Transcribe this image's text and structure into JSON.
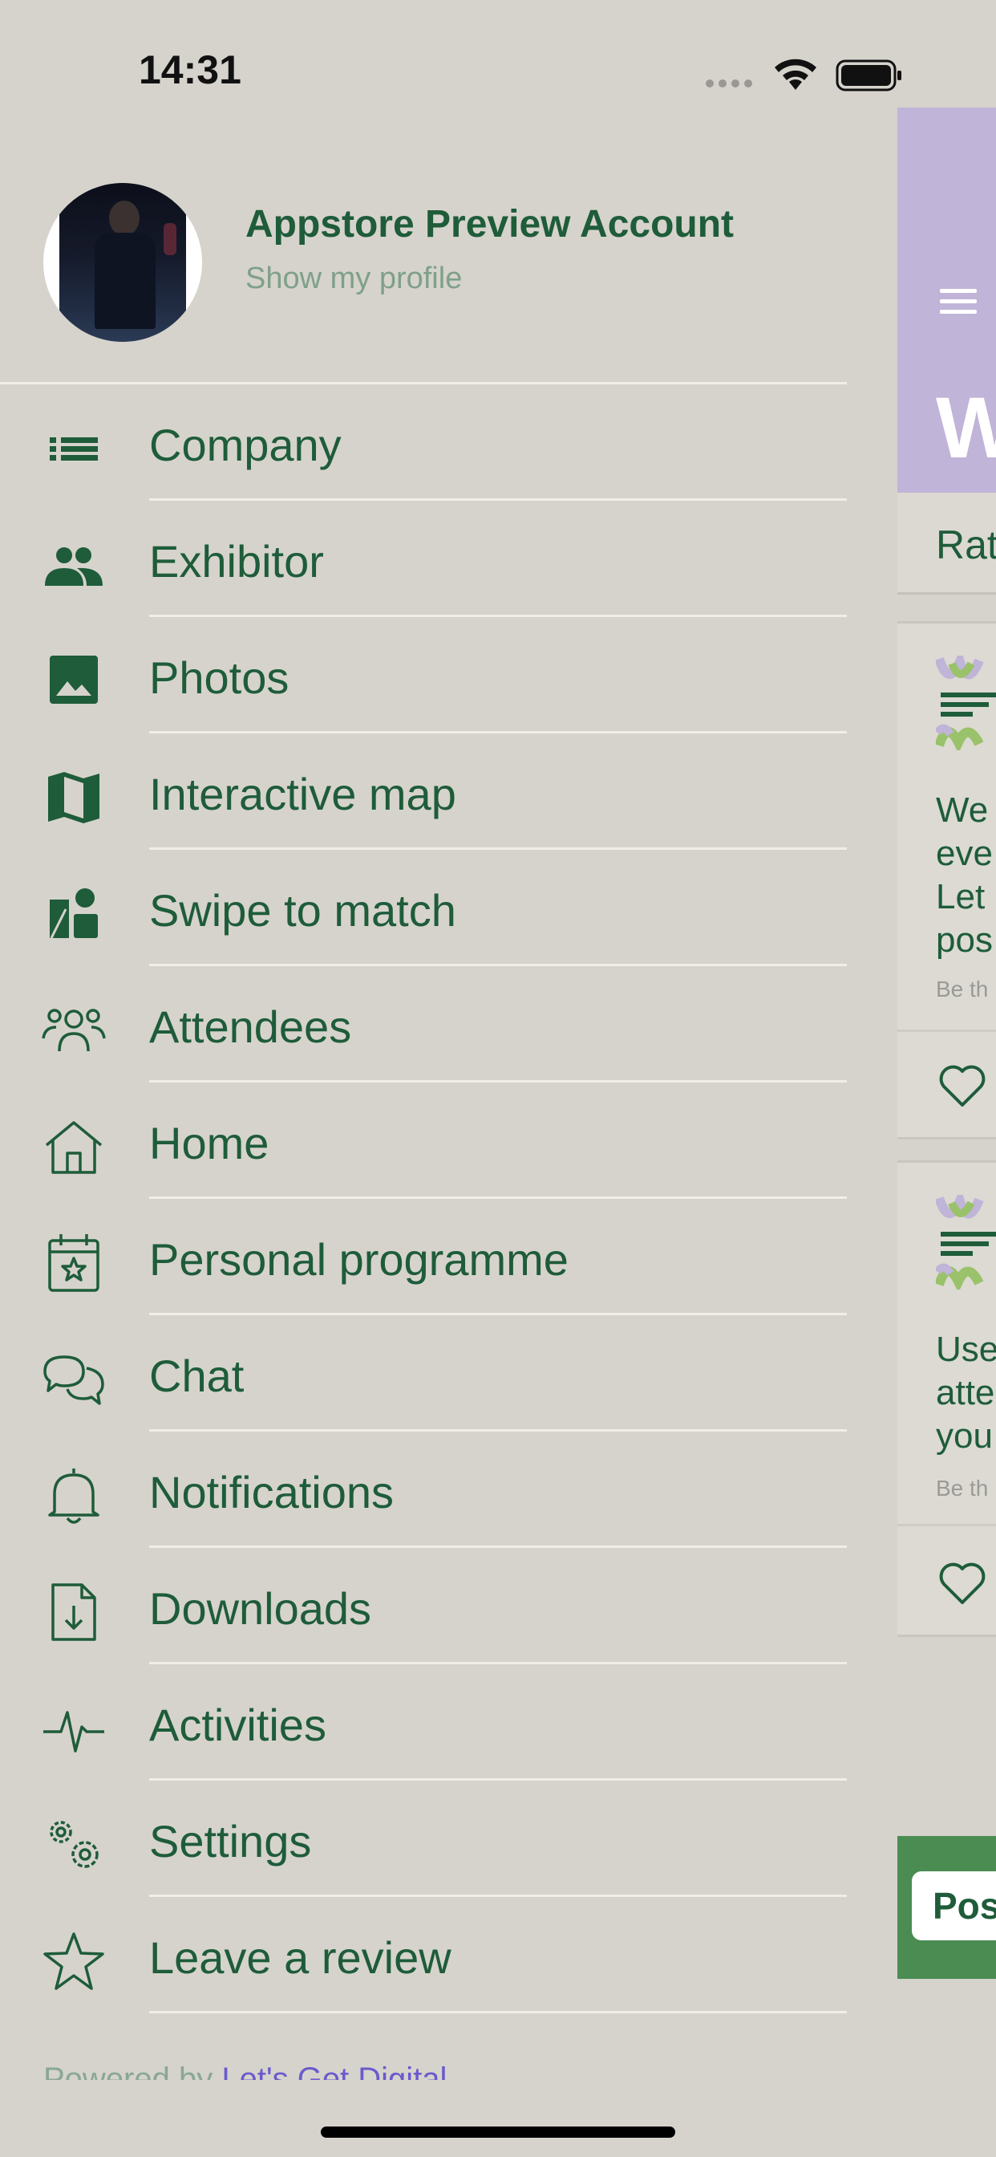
{
  "status_bar": {
    "time": "14:31"
  },
  "profile": {
    "name": "Appstore Preview Account",
    "subtitle": "Show my profile"
  },
  "menu": [
    {
      "label": "Company",
      "icon": "list-icon"
    },
    {
      "label": "Exhibitor",
      "icon": "people-icon"
    },
    {
      "label": "Photos",
      "icon": "image-icon"
    },
    {
      "label": "Interactive map",
      "icon": "map-icon"
    },
    {
      "label": "Swipe to match",
      "icon": "shapes-icon"
    },
    {
      "label": "Attendees",
      "icon": "attendees-icon"
    },
    {
      "label": "Home",
      "icon": "home-icon"
    },
    {
      "label": "Personal programme",
      "icon": "calendar-star-icon"
    },
    {
      "label": "Chat",
      "icon": "chat-icon"
    },
    {
      "label": "Notifications",
      "icon": "bell-icon"
    },
    {
      "label": "Downloads",
      "icon": "download-file-icon"
    },
    {
      "label": "Activities",
      "icon": "activity-icon"
    },
    {
      "label": "Settings",
      "icon": "gears-icon"
    },
    {
      "label": "Leave a review",
      "icon": "star-icon"
    }
  ],
  "footer": {
    "powered_prefix": "Powered by ",
    "powered_link": "Let's Get Digital"
  },
  "background_page": {
    "header_letter": "W",
    "tab_label": "Rat",
    "cards": [
      {
        "text": "We\neve\nLet\npos",
        "meta": "Be th"
      },
      {
        "text": "Use\natte\nyou",
        "meta": "Be th"
      }
    ],
    "post_button": "Pos"
  },
  "colors": {
    "accent": "#1e5c3a",
    "header": "#c0b4d8",
    "post_bar": "#4a8c52",
    "background": "#d6d3cc"
  }
}
